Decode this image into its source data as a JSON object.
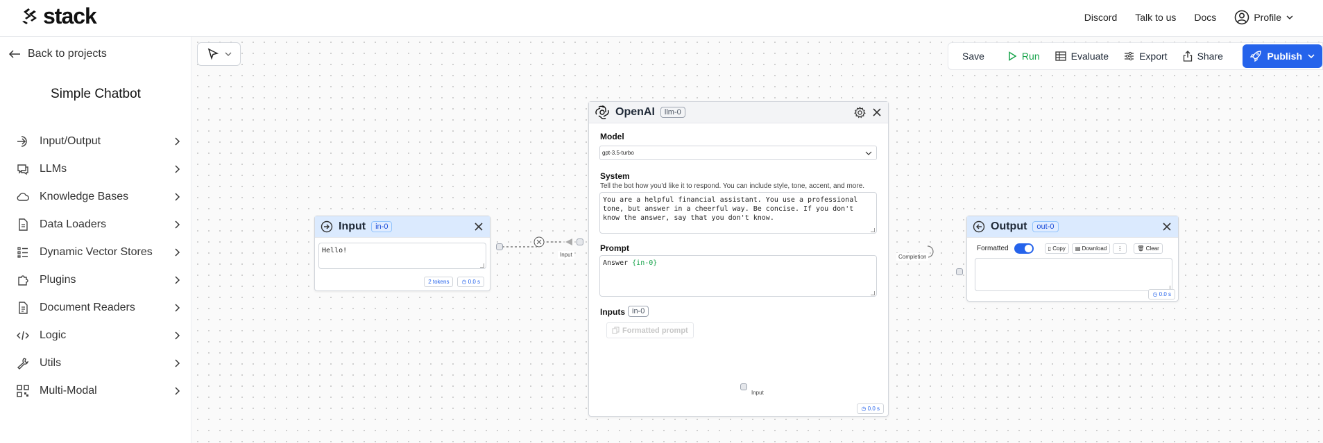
{
  "topbar": {
    "logo_text": "stack",
    "nav": {
      "discord": "Discord",
      "talk": "Talk to us",
      "docs": "Docs",
      "profile": "Profile"
    }
  },
  "sidebar": {
    "back_label": "Back to projects",
    "project_title": "Simple Chatbot",
    "items": [
      {
        "label": "Input/Output",
        "icon": "arrow-right-circle-icon"
      },
      {
        "label": "LLMs",
        "icon": "chat-icon"
      },
      {
        "label": "Knowledge Bases",
        "icon": "cloud-icon"
      },
      {
        "label": "Data Loaders",
        "icon": "document-icon"
      },
      {
        "label": "Dynamic Vector Stores",
        "icon": "list-icon"
      },
      {
        "label": "Plugins",
        "icon": "puzzle-icon"
      },
      {
        "label": "Document Readers",
        "icon": "document-text-icon"
      },
      {
        "label": "Logic",
        "icon": "code-icon"
      },
      {
        "label": "Utils",
        "icon": "wrench-icon"
      },
      {
        "label": "Multi-Modal",
        "icon": "qr-code-icon"
      }
    ]
  },
  "toolbar": {
    "save": "Save",
    "run": "Run",
    "evaluate": "Evaluate",
    "export": "Export",
    "share": "Share",
    "publish": "Publish",
    "colors": {
      "run": "#16a34a",
      "publish": "#2563eb"
    }
  },
  "input_node": {
    "title": "Input",
    "badge": "in-0",
    "value": "Hello!",
    "tokens": "2 tokens",
    "time": "0.0 s"
  },
  "llm_node": {
    "title": "OpenAI",
    "badge": "llm-0",
    "model_label": "Model",
    "model_value": "gpt-3.5-turbo",
    "system_label": "System",
    "system_hint": "Tell the bot how you'd like it to respond. You can include style, tone, accent, and more.",
    "system_value": "You are a helpful financial assistant. You use a professional tone, but answer in a cheerful way. Be concise. If you don't know the answer, say that you don't know.",
    "prompt_label": "Prompt",
    "prompt_prefix": "Answer ",
    "prompt_var": "{in-0}",
    "inputs_label": "Inputs",
    "inputs_badge": "in-0",
    "formatted_prompt": "Formatted prompt",
    "time": "0.0 s"
  },
  "output_node": {
    "title": "Output",
    "badge": "out-0",
    "formatted_label": "Formatted",
    "formatted_on": true,
    "copy": "Copy",
    "download": "Download",
    "more": "⋮",
    "clear": "Clear",
    "time": "0.0 s"
  },
  "edges": {
    "input_label": "Input",
    "completion_label": "Completion",
    "bottom_input_label": "Input"
  }
}
